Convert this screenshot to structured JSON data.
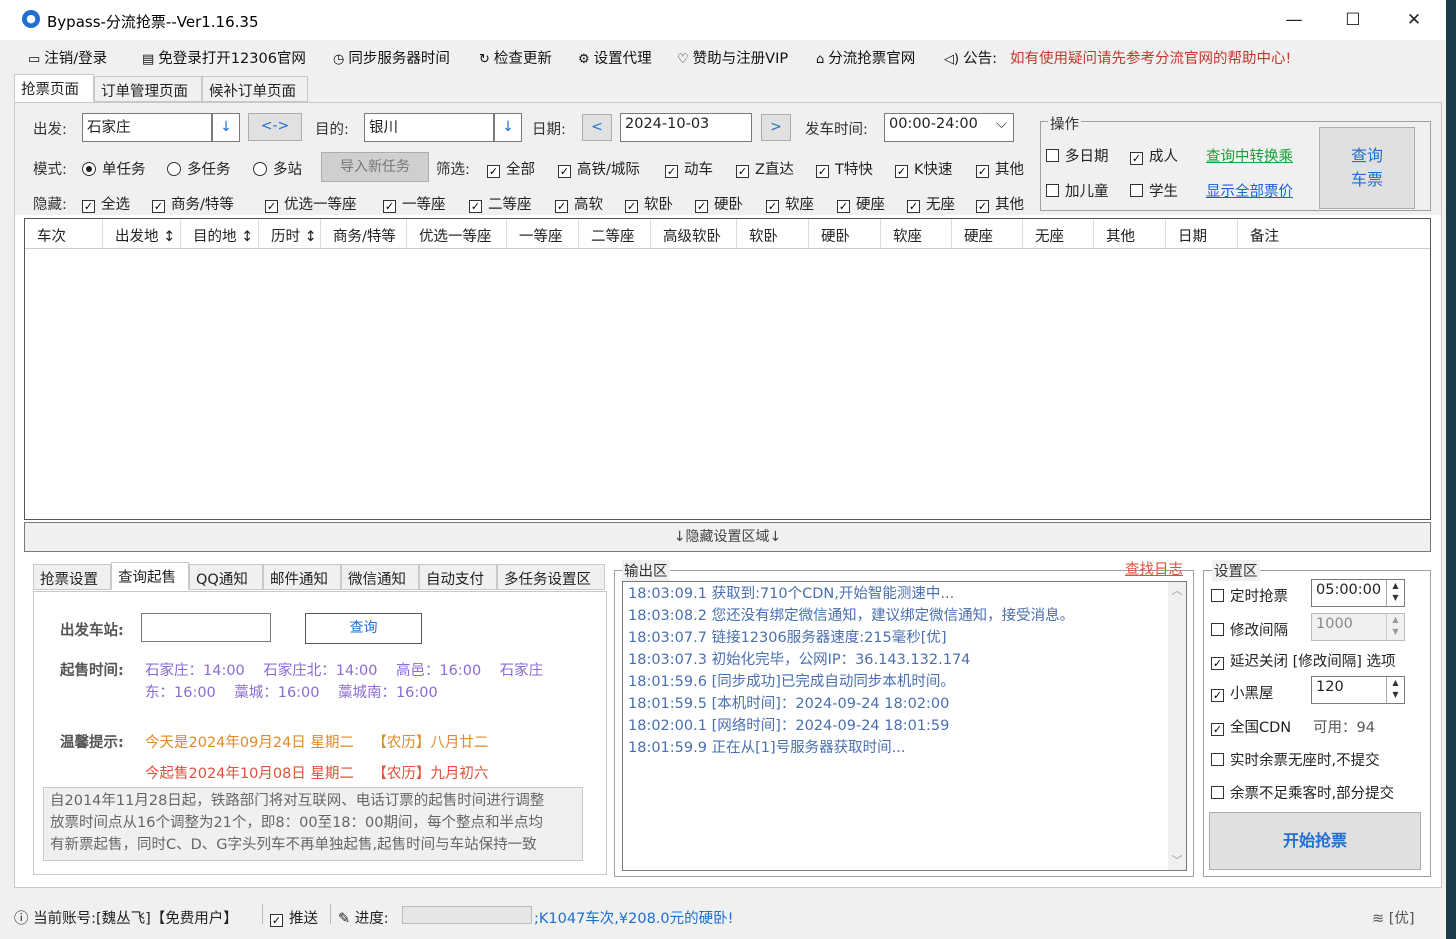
{
  "window": {
    "title": "Bypass-分流抢票--Ver1.16.35"
  },
  "menu": [
    {
      "icon": "monitor-icon",
      "label": "注销/登录"
    },
    {
      "icon": "browser-icon",
      "label": "免登录打开12306官网"
    },
    {
      "icon": "clock-icon",
      "label": "同步服务器时间"
    },
    {
      "icon": "refresh-icon",
      "label": "检查更新"
    },
    {
      "icon": "gear-icon",
      "label": "设置代理"
    },
    {
      "icon": "heart-icon",
      "label": "赞助与注册VIP"
    },
    {
      "icon": "home-icon",
      "label": "分流抢票官网"
    },
    {
      "icon": "speaker-icon",
      "label": "公告:"
    }
  ],
  "announcement": "如有使用疑问请先参考分流官网的帮助中心!",
  "tabs": [
    "抢票页面",
    "订单管理页面",
    "候补订单页面"
  ],
  "query": {
    "from_label": "出发:",
    "from": "石家庄",
    "swap": "<->",
    "to_label": "目的:",
    "to": "银川",
    "date_label": "日期:",
    "date": "2024-10-03",
    "prev": "<",
    "next": ">",
    "time_label": "发车时间:",
    "time": "00:00-24:00"
  },
  "mode": {
    "label": "模式:",
    "options": [
      "单任务",
      "多任务",
      "多站"
    ],
    "selected": 0,
    "import_btn": "导入新任务"
  },
  "filter": {
    "label": "筛选:",
    "items": [
      "全部",
      "高铁/城际",
      "动车",
      "Z直达",
      "T特快",
      "K快速",
      "其他"
    ]
  },
  "hide": {
    "label": "隐藏:",
    "items": [
      "全选",
      "商务/特等",
      "优选一等座",
      "一等座",
      "二等座",
      "高软",
      "软卧",
      "硬卧",
      "软座",
      "硬座",
      "无座",
      "其他"
    ]
  },
  "ops": {
    "title": "操作",
    "multi_date": "多日期",
    "adult": "成人",
    "child": "加儿童",
    "student": "学生",
    "link1": "查询中转换乘",
    "link2": "显示全部票价",
    "query_btn_1": "查询",
    "query_btn_2": "车票"
  },
  "grid_headers": [
    "车次",
    "出发地 ↕",
    "目的地 ↕",
    "历时 ↕",
    "商务/特等",
    "优选一等座",
    "一等座",
    "二等座",
    "高级软卧",
    "软卧",
    "硬卧",
    "软座",
    "硬座",
    "无座",
    "其他",
    "日期",
    "备注"
  ],
  "hide_settings": "↓隐藏设置区域↓",
  "lower_tabs": [
    "抢票设置",
    "查询起售",
    "QQ通知",
    "邮件通知",
    "微信通知",
    "自动支付",
    "多任务设置区"
  ],
  "sale": {
    "station_label": "出发车站:",
    "query_btn": "查询",
    "time_label": "起售时间:",
    "times_line1": "石家庄：14:00    石家庄北：14:00    高邑：16:00    石家庄",
    "times_line2": "东：16:00    藁城：16:00    藁城南：16:00",
    "tip_label": "温馨提示:",
    "tip1": "今天是2024年09月24日 星期二    【农历】八月廿二",
    "tip2": "今起售2024年10月08日 星期二    【农历】九月初六",
    "notice": [
      "自2014年11月28日起，铁路部门将对互联网、电话订票的起售时间进行调整",
      "放票时间点从16个调整为21个，即8：00至18：00期间，每个整点和半点均",
      "有新票起售，同时C、D、G字头列车不再单独起售,起售时间与车站保持一致"
    ]
  },
  "output": {
    "title": "输出区",
    "find_log": "查找日志",
    "lines": [
      "18:03:09.1  获取到:710个CDN,开始智能测速中...",
      "18:03:08.2  您还没有绑定微信通知，建议绑定微信通知，接受消息。",
      "18:03:07.7  链接12306服务器速度:215毫秒[优]",
      "18:03:07.3  初始化完毕，公网IP：36.143.132.174",
      "18:01:59.6  [同步成功]已完成自动同步本机时间。",
      "18:01:59.5  [本机时间]：2024-09-24 18:02:00",
      "18:02:00.1  [网络时间]：2024-09-24 18:01:59",
      "18:01:59.9  正在从[1]号服务器获取时间..."
    ]
  },
  "settings": {
    "title": "设置区",
    "timed": "定时抢票",
    "timed_val": "05:00:00",
    "interval": "修改间隔",
    "interval_val": "1000",
    "delay": "延迟关闭 [修改间隔] 选项",
    "blackroom": "小黑屋",
    "blackroom_val": "120",
    "cdn": "全国CDN",
    "cdn_avail": "可用：94",
    "opt1": "实时余票无座时,不提交",
    "opt2": "余票不足乘客时,部分提交",
    "start_btn": "开始抢票"
  },
  "status": {
    "account": "当前账号:[魏丛飞]【免费用户】",
    "push": "推送",
    "progress_label": "进度:",
    "message": ";K1047车次,¥208.0元的硬卧!",
    "net": "[优]"
  }
}
